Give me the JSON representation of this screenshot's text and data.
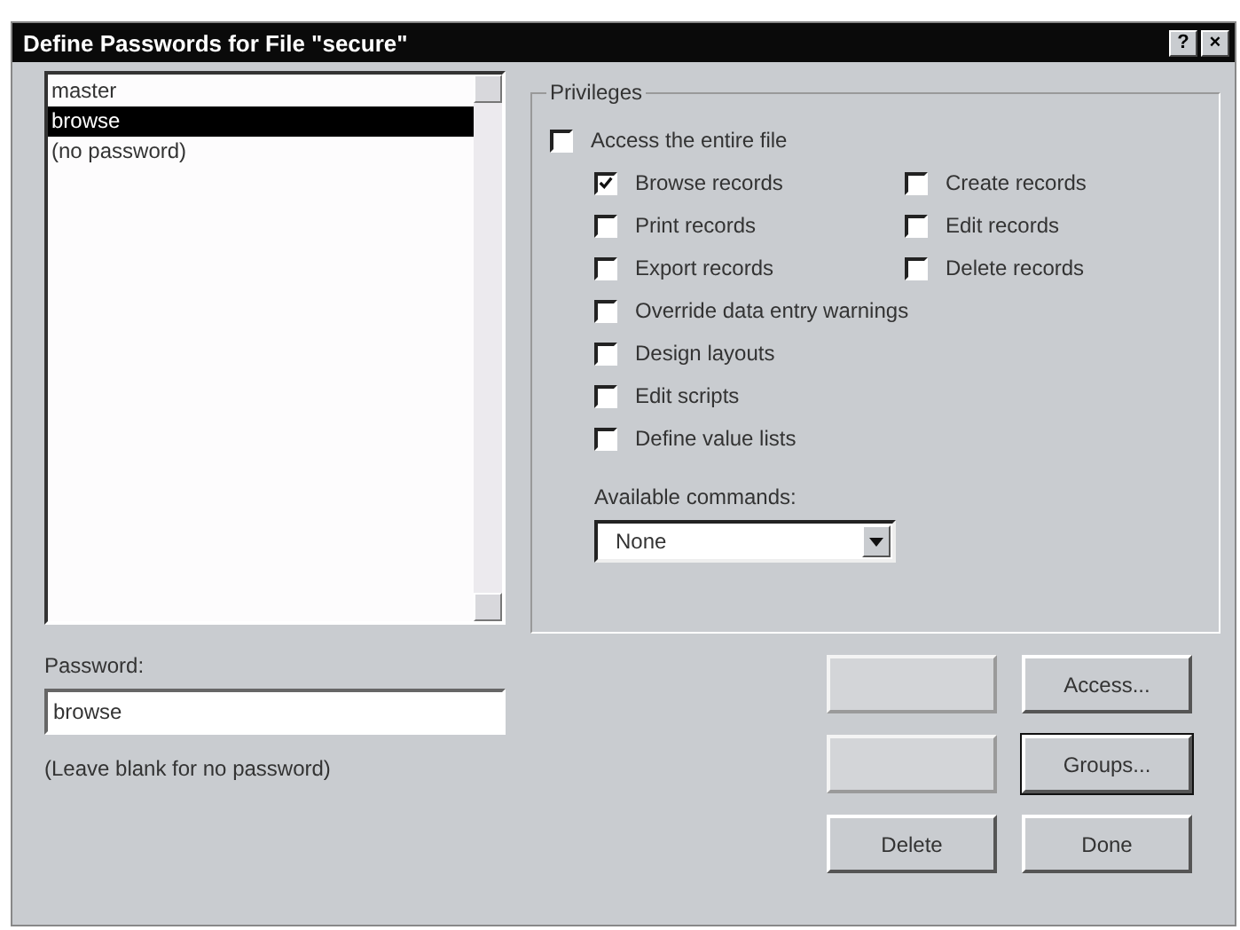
{
  "window": {
    "title": "Define Passwords for File \"secure\"",
    "help": "?",
    "close": "×"
  },
  "password_list": {
    "items": [
      {
        "label": "master",
        "selected": false
      },
      {
        "label": "browse",
        "selected": true
      },
      {
        "label": "(no password)",
        "selected": false
      }
    ]
  },
  "password": {
    "label": "Password:",
    "value": "browse",
    "hint": "(Leave blank for no password)"
  },
  "privileges": {
    "title": "Privileges",
    "entire_file": {
      "label": "Access the entire file",
      "checked": false
    },
    "grid": [
      {
        "label": "Browse records",
        "checked": true
      },
      {
        "label": "Create records",
        "checked": false
      },
      {
        "label": "Print records",
        "checked": false
      },
      {
        "label": "Edit records",
        "checked": false
      },
      {
        "label": "Export records",
        "checked": false
      },
      {
        "label": "Delete records",
        "checked": false
      }
    ],
    "list": [
      {
        "label": "Override data entry warnings",
        "checked": false
      },
      {
        "label": "Design layouts",
        "checked": false
      },
      {
        "label": "Edit scripts",
        "checked": false
      },
      {
        "label": "Define value lists",
        "checked": false
      }
    ],
    "commands": {
      "label": "Available commands:",
      "value": "None"
    }
  },
  "buttons": [
    {
      "disabled": true
    },
    {
      "label": "Access...",
      "disabled": false
    },
    {
      "disabled": true
    },
    {
      "label": "Groups...",
      "disabled": false,
      "default": true
    },
    {
      "label": "Delete",
      "disabled": false
    },
    {
      "label": "Done",
      "disabled": false
    }
  ]
}
